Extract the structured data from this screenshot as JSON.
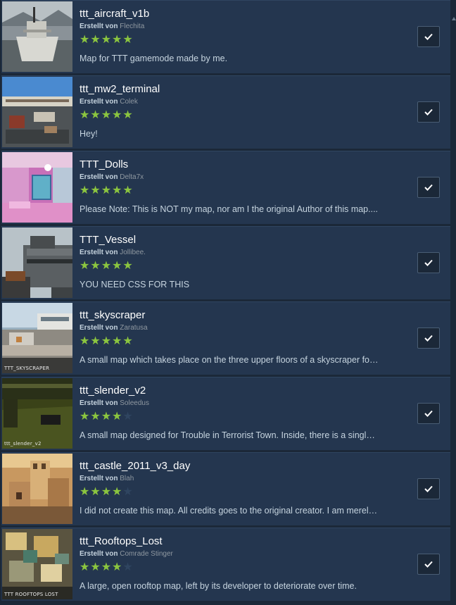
{
  "author_prefix": "Erstellt von",
  "items": [
    {
      "title": "ttt_aircraft_v1b",
      "author": "Flechita",
      "rating": 5,
      "description": "Map for TTT gamemode made by me.",
      "thumb": "aircraft"
    },
    {
      "title": "ttt_mw2_terminal",
      "author": "Colek",
      "rating": 5,
      "description": "Hey!",
      "thumb": "terminal"
    },
    {
      "title": "TTT_Dolls",
      "author": "Delta7x",
      "rating": 5,
      "description": "Please Note: This is NOT my map, nor am I the original Author of this map....",
      "thumb": "dolls"
    },
    {
      "title": "TTT_Vessel",
      "author": "Jollibee.",
      "rating": 5,
      "description": "YOU NEED CSS FOR THIS",
      "thumb": "vessel"
    },
    {
      "title": "ttt_skyscraper",
      "author": "Zaratusa",
      "rating": 5,
      "description": "A small map which takes place on the three upper floors of a skyscraper fo…",
      "thumb": "skyscraper",
      "thumb_label": "TTT_SKYSCRAPER"
    },
    {
      "title": "ttt_slender_v2",
      "author": "Soleedus",
      "rating": 4,
      "description": "A small map designed for Trouble in Terrorist Town. Inside, there is a singl…",
      "thumb": "slender",
      "thumb_label": "ttt_slender_v2"
    },
    {
      "title": "ttt_castle_2011_v3_day",
      "author": "Blah",
      "rating": 4,
      "description": "I did not create this map. All credits goes to the original creator. I am merel…",
      "thumb": "castle"
    },
    {
      "title": "ttt_Rooftops_Lost",
      "author": "Comrade Stinger",
      "rating": 4,
      "description": "A large, open rooftop map, left by its developer to deteriorate over time.",
      "thumb": "rooftops",
      "thumb_label": "TTT ROOFTOPS LOST"
    }
  ],
  "colors": {
    "star_on": "#8bc53f",
    "star_off": "#2f4560",
    "row_bg": "#24364f",
    "page_bg": "#1b2838"
  },
  "icons": {
    "check": "checkmark-icon",
    "star": "star-icon"
  }
}
